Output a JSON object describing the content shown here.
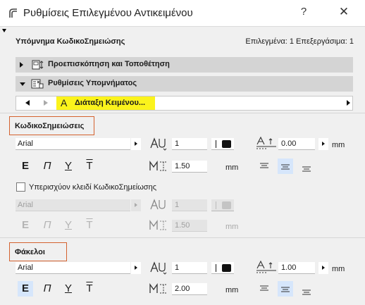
{
  "window": {
    "title": "Ρυθμίσεις Επιλεγμένου Αντικειμένου",
    "help_glyph": "?",
    "close_glyph": "✕"
  },
  "header": {
    "title": "Υπόμνημα ΚωδικοΣημειώσης",
    "status": "Επιλεγμένα: 1 Επεξεργάσιμα: 1"
  },
  "sections": {
    "preview": "Προεπισκόπηση και Τοποθέτηση",
    "legend_settings": "Ρυθμίσεις Υπομνήματος"
  },
  "nav": {
    "selected_label": "Διάταξη Κειμένου...",
    "selected_icon": "A"
  },
  "keynotes": {
    "label": "ΚωδικοΣημειώσεις",
    "font": "Arial",
    "pen": "1",
    "size": "1.50",
    "size_unit": "mm",
    "spacing": "0.00",
    "spacing_unit": "mm"
  },
  "override": {
    "label": "Υπερισχύον κλειδί ΚωδικοΣημείωσης",
    "checked": false,
    "font": "Arial",
    "pen": "1",
    "size": "1.50",
    "size_unit": "mm"
  },
  "folders": {
    "label": "Φάκελοι",
    "font": "Arial",
    "pen": "1",
    "size": "2.00",
    "size_unit": "mm",
    "spacing": "1.00",
    "spacing_unit": "mm"
  },
  "style_glyphs": {
    "bold": "E",
    "italic": "Π",
    "underline": "Y",
    "strike": "T"
  },
  "colors": {
    "highlight": "#fbf31c",
    "group_border": "#d4622f",
    "active_button": "#d6e6fb"
  },
  "icons": [
    "app-icon",
    "help-icon",
    "close-icon",
    "preview-icon",
    "settings-icon",
    "text-layout-icon",
    "font-size-icon",
    "text-height-icon",
    "line-spacing-icon",
    "pen-color-icon",
    "align-left-icon",
    "align-center-icon",
    "align-right-icon"
  ]
}
